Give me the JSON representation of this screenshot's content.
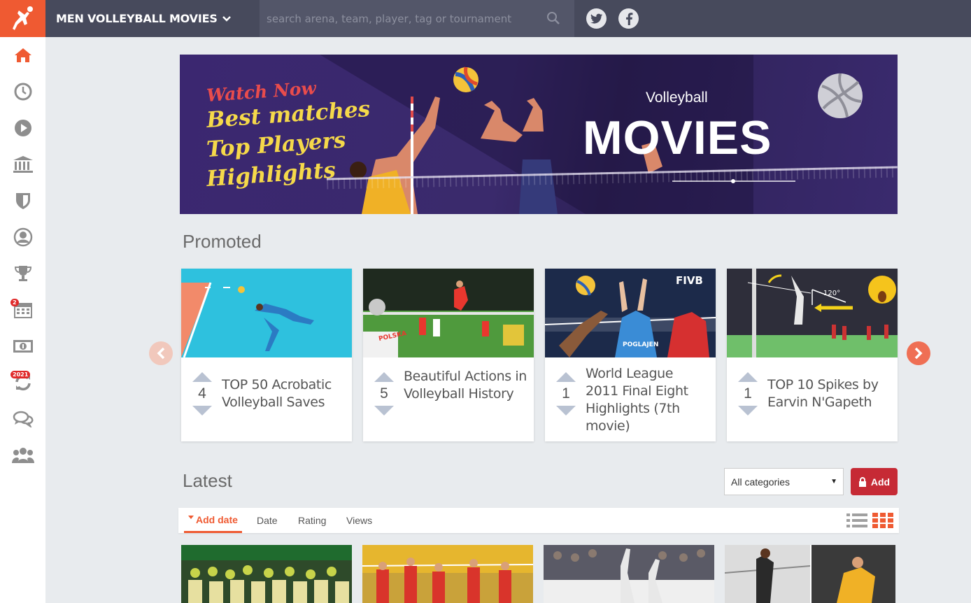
{
  "header": {
    "site_title": "MEN VOLLEYBALL MOVIES",
    "search_placeholder": "search arena, team, player, tag or tournament",
    "social": [
      "twitter-icon",
      "facebook-icon"
    ]
  },
  "sidebar": {
    "items": [
      {
        "icon": "home-icon",
        "active": true
      },
      {
        "icon": "clock-icon"
      },
      {
        "icon": "play-icon"
      },
      {
        "icon": "arena-icon"
      },
      {
        "icon": "shield-icon"
      },
      {
        "icon": "user-icon"
      },
      {
        "icon": "trophy-icon"
      },
      {
        "icon": "calendar-icon",
        "badge": "2"
      },
      {
        "icon": "money-icon"
      },
      {
        "icon": "refresh-icon",
        "badge": "2021"
      },
      {
        "icon": "chat-icon"
      },
      {
        "icon": "group-icon"
      }
    ]
  },
  "banner": {
    "watch_now": "Watch Now",
    "lines": [
      "Best matches",
      "Top Players",
      "Highlights"
    ],
    "subtitle": "Volleyball",
    "title": "MOVIES"
  },
  "promoted": {
    "heading": "Promoted",
    "cards": [
      {
        "votes": "4",
        "title": "TOP 50 Acrobatic Volleyball Saves"
      },
      {
        "votes": "5",
        "title": "Beautiful Actions in Volleyball History"
      },
      {
        "votes": "1",
        "title": "World League 2011 Final Eight Highlights (7th movie)"
      },
      {
        "votes": "1",
        "title": "TOP 10 Spikes by Earvin N'Gapeth"
      }
    ],
    "thumb_texts": {
      "fivb": "FIVB",
      "polska": "POLSKA",
      "poglajen": "POGLAJEN",
      "angle": "120°"
    }
  },
  "latest": {
    "heading": "Latest",
    "category_select": "All categories",
    "add_label": "Add",
    "sort": [
      {
        "label": "Add date",
        "active": true
      },
      {
        "label": "Date"
      },
      {
        "label": "Rating"
      },
      {
        "label": "Views"
      }
    ]
  },
  "colors": {
    "accent": "#ef5a32",
    "topbar": "#474a5c",
    "add_button": "#c62a35"
  }
}
